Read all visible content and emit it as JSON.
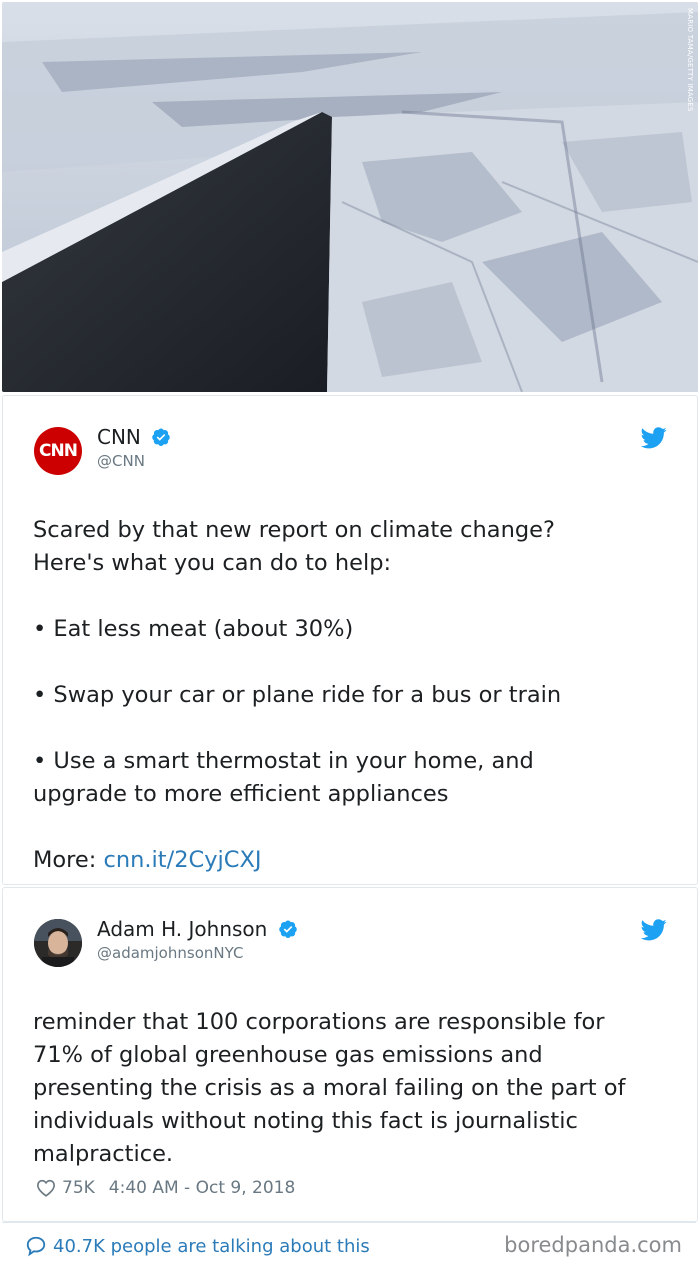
{
  "photo": {
    "alt_icon": "arctic-sea-ice-photo",
    "credit": "MARIO TAMA/GETTY IMAGES"
  },
  "tweet1": {
    "avatar_text": "CNN",
    "name": "CNN",
    "handle": "@CNN",
    "lines": [
      "Scared by that new report on climate change?",
      "Here's what you can do to help:",
      "",
      "• Eat less meat (about 30%)",
      "",
      "• Swap your car or plane ride for a bus or train",
      "",
      "• Use a smart thermostat in your home, and",
      "upgrade to more efficient appliances",
      ""
    ],
    "more_label": "More: ",
    "more_link": "cnn.it/2CyjCXJ"
  },
  "tweet2": {
    "name": "Adam H. Johnson",
    "handle": "@adamjohnsonNYC",
    "lines": [
      "reminder that 100 corporations are responsible for",
      "71% of global greenhouse gas emissions and",
      "presenting the crisis as a moral failing on the part of",
      "individuals without noting this fact is journalistic",
      "malpractice."
    ],
    "likes": "75K",
    "timestamp": "4:40 AM - Oct 9, 2018"
  },
  "footer": {
    "talking": "40.7K people are talking about this",
    "brand": "boredpanda.com"
  },
  "colors": {
    "link": "#2b7bb9",
    "verified": "#1da1f2",
    "cnn_red": "#cc0000",
    "muted": "#697882"
  }
}
